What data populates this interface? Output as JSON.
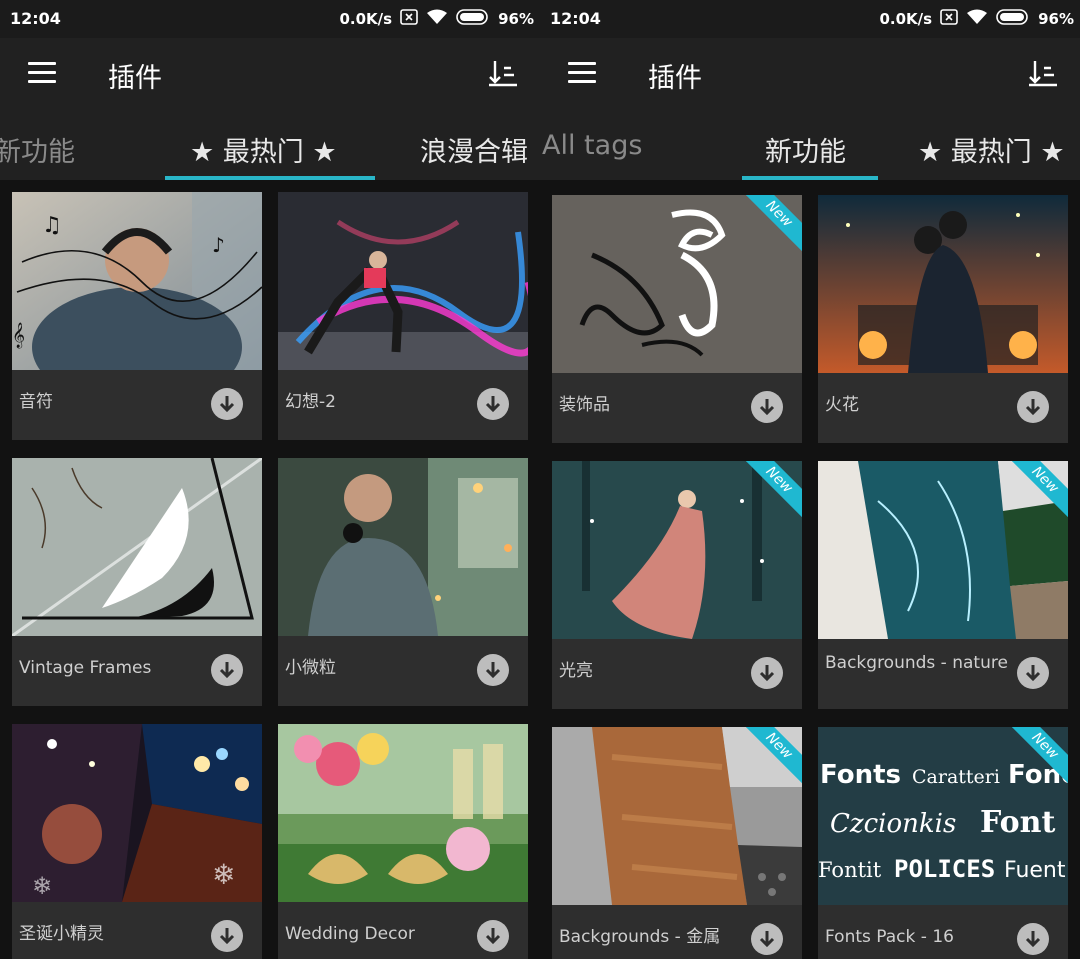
{
  "left": {
    "status": {
      "time": "12:04",
      "net": "0.0K/s",
      "battery": "96%"
    },
    "app_title": "插件",
    "tabs": [
      "新功能",
      "★ 最热门 ★",
      "浪漫合辑"
    ],
    "cards": [
      {
        "label": "音符",
        "new": false
      },
      {
        "label": "幻想-2",
        "new": false
      },
      {
        "label": "Vintage Frames",
        "new": false
      },
      {
        "label": "小微粒",
        "new": false
      },
      {
        "label": "圣诞小精灵",
        "new": false
      },
      {
        "label": "Wedding Decor",
        "new": false
      }
    ]
  },
  "right": {
    "status": {
      "time": "12:04",
      "net": "0.0K/s",
      "battery": "96%"
    },
    "app_title": "插件",
    "tabs": [
      "All tags",
      "新功能",
      "★ 最热门 ★"
    ],
    "cards": [
      {
        "label": "装饰品",
        "new": true
      },
      {
        "label": "火花",
        "new": false
      },
      {
        "label": "光亮",
        "new": true
      },
      {
        "label": "Backgrounds - nature",
        "new": true
      },
      {
        "label": "Backgrounds - 金属",
        "new": true
      },
      {
        "label": "Fonts Pack - 16",
        "new": true
      }
    ]
  },
  "badge_text": "New",
  "fonts_thumb_words": [
    "Fonts",
    "Caratteri",
    "Fonc",
    "Czcionkis",
    "Font",
    "Fontit",
    "POLICES",
    "Fuent"
  ],
  "colors": {
    "accent": "#29b6c8",
    "ribbon": "#1fb8d1",
    "appbar": "#212121",
    "card": "#2e2e2e"
  },
  "icons": {
    "menu": "hamburger-icon",
    "sort": "sort-icon",
    "download": "download-icon"
  }
}
